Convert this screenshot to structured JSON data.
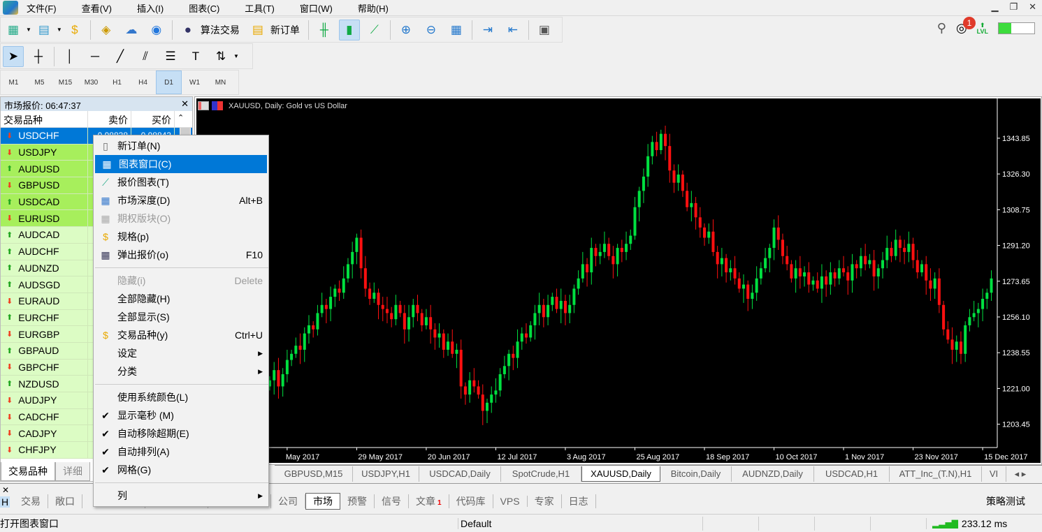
{
  "menubar": {
    "items": [
      "文件(F)",
      "查看(V)",
      "插入(I)",
      "图表(C)",
      "工具(T)",
      "窗口(W)",
      "帮助(H)"
    ]
  },
  "toolbar": {
    "algo_label": "算法交易",
    "new_order_label": "新订单",
    "notification_count": "1",
    "level_label": "LVL",
    "level_fill": 0.35
  },
  "timeframes": {
    "items": [
      "M1",
      "M5",
      "M15",
      "M30",
      "H1",
      "H4",
      "D1",
      "W1",
      "MN"
    ],
    "active": "D1"
  },
  "market_watch": {
    "title": "市场报价: 06:47:37",
    "columns": [
      "交易品种",
      "卖价",
      "买价"
    ],
    "rows": [
      {
        "symbol": "USDCHF",
        "dir": "down",
        "bid": "0.98838",
        "ask": "0.98843",
        "state": "selected"
      },
      {
        "symbol": "USDJPY",
        "dir": "down",
        "state": "hot"
      },
      {
        "symbol": "AUDUSD",
        "dir": "up",
        "state": "hot"
      },
      {
        "symbol": "GBPUSD",
        "dir": "down",
        "state": "hot"
      },
      {
        "symbol": "USDCAD",
        "dir": "up",
        "state": "hot"
      },
      {
        "symbol": "EURUSD",
        "dir": "down",
        "state": "hot"
      },
      {
        "symbol": "AUDCAD",
        "dir": "up",
        "state": "cold"
      },
      {
        "symbol": "AUDCHF",
        "dir": "up",
        "state": "cold"
      },
      {
        "symbol": "AUDNZD",
        "dir": "up",
        "state": "cold"
      },
      {
        "symbol": "AUDSGD",
        "dir": "up",
        "state": "cold"
      },
      {
        "symbol": "EURAUD",
        "dir": "down",
        "state": "cold"
      },
      {
        "symbol": "EURCHF",
        "dir": "up",
        "state": "cold"
      },
      {
        "symbol": "EURGBP",
        "dir": "down",
        "state": "cold"
      },
      {
        "symbol": "GBPAUD",
        "dir": "up",
        "state": "cold"
      },
      {
        "symbol": "GBPCHF",
        "dir": "down",
        "state": "cold"
      },
      {
        "symbol": "NZDUSD",
        "dir": "up",
        "state": "cold"
      },
      {
        "symbol": "AUDJPY",
        "dir": "down",
        "state": "cold"
      },
      {
        "symbol": "CADCHF",
        "dir": "down",
        "state": "cold"
      },
      {
        "symbol": "CADJPY",
        "dir": "down",
        "state": "cold"
      },
      {
        "symbol": "CHFJPY",
        "dir": "down",
        "state": "cold"
      }
    ],
    "tabs": [
      "交易品种",
      "详细"
    ]
  },
  "context_menu": {
    "items": [
      {
        "label": "新订单(N)",
        "icon": "new-order-icon"
      },
      {
        "label": "图表窗口(C)",
        "icon": "chart-window-icon",
        "highlighted": true
      },
      {
        "label": "报价图表(T)",
        "icon": "tick-chart-icon"
      },
      {
        "label": "市场深度(D)",
        "icon": "depth-of-market-icon",
        "shortcut": "Alt+B"
      },
      {
        "label": "期权版块(O)",
        "icon": "options-board-icon",
        "disabled": true
      },
      {
        "label": "规格(p)",
        "icon": "specification-icon"
      },
      {
        "label": "弹出报价(o)",
        "icon": "popup-prices-icon",
        "shortcut": "F10"
      },
      {
        "sep": true
      },
      {
        "label": "隐藏(i)",
        "shortcut": "Delete",
        "disabled": true
      },
      {
        "label": "全部隐藏(H)"
      },
      {
        "label": "全部显示(S)"
      },
      {
        "label": "交易品种(y)",
        "icon": "symbols-icon",
        "shortcut": "Ctrl+U"
      },
      {
        "label": "设定",
        "submenu": true
      },
      {
        "label": "分类",
        "submenu": true
      },
      {
        "sep": true
      },
      {
        "label": "使用系统颜色(L)"
      },
      {
        "label": "显示毫秒 (M)",
        "checked": true
      },
      {
        "label": "自动移除超期(E)",
        "checked": true
      },
      {
        "label": "自动排列(A)",
        "checked": true
      },
      {
        "label": "网格(G)",
        "checked": true
      },
      {
        "sep": true
      },
      {
        "label": "列",
        "submenu": true
      }
    ]
  },
  "chart": {
    "title": "XAUUSD, Daily:  Gold vs US Dollar"
  },
  "chart_data": {
    "type": "candlestick",
    "symbol": "XAUUSD",
    "timeframe": "Daily",
    "ylim": [
      1192,
      1362
    ],
    "grid": false,
    "yticks": [
      "1343.85",
      "1326.30",
      "1308.75",
      "1291.20",
      "1273.65",
      "1256.10",
      "1238.55",
      "1221.00",
      "1203.45"
    ],
    "xticks": [
      "May 2017",
      "29 May 2017",
      "20 Jun 2017",
      "12 Jul 2017",
      "3 Aug 2017",
      "25 Aug 2017",
      "18 Sep 2017",
      "10 Oct 2017",
      "1 Nov 2017",
      "23 Nov 2017",
      "15 Dec 2017"
    ],
    "up_color": "#00e040",
    "down_color": "#ff1010",
    "closes": [
      1225,
      1230,
      1222,
      1228,
      1235,
      1238,
      1242,
      1240,
      1248,
      1252,
      1250,
      1258,
      1262,
      1260,
      1266,
      1270,
      1268,
      1275,
      1282,
      1288,
      1295,
      1280,
      1270,
      1265,
      1268,
      1262,
      1260,
      1258,
      1255,
      1262,
      1258,
      1250,
      1256,
      1262,
      1258,
      1252,
      1256,
      1250,
      1246,
      1248,
      1240,
      1244,
      1238,
      1240,
      1222,
      1218,
      1225,
      1222,
      1218,
      1210,
      1214,
      1218,
      1220,
      1228,
      1232,
      1238,
      1236,
      1244,
      1248,
      1246,
      1252,
      1258,
      1262,
      1256,
      1262,
      1266,
      1260,
      1264,
      1258,
      1262,
      1270,
      1275,
      1282,
      1278,
      1290,
      1286,
      1288,
      1292,
      1286,
      1282,
      1290,
      1288,
      1292,
      1296,
      1310,
      1318,
      1325,
      1335,
      1342,
      1338,
      1346,
      1340,
      1328,
      1322,
      1326,
      1318,
      1310,
      1312,
      1305,
      1300,
      1295,
      1298,
      1288,
      1282,
      1285,
      1278,
      1280,
      1275,
      1270,
      1272,
      1265,
      1268,
      1275,
      1280,
      1285,
      1290,
      1300,
      1294,
      1286,
      1282,
      1275,
      1280,
      1276,
      1278,
      1272,
      1274,
      1270,
      1276,
      1272,
      1278,
      1275,
      1280,
      1278,
      1274,
      1282,
      1280,
      1286,
      1282,
      1284,
      1276,
      1280,
      1284,
      1290,
      1286,
      1294,
      1290,
      1288,
      1292,
      1284,
      1278,
      1282,
      1274,
      1270,
      1275,
      1262,
      1250,
      1245,
      1240,
      1244,
      1238,
      1252,
      1256,
      1258,
      1260,
      1265,
      1268,
      1275
    ]
  },
  "chart_tabs": {
    "items": [
      "GBPUSD,M15",
      "USDJPY,H1",
      "USDCAD,Daily",
      "SpotCrude,H1",
      "XAUUSD,Daily",
      "Bitcoin,Daily",
      "AUDNZD,Daily",
      "USDCAD,H1",
      "ATT_Inc_(T.N),H1",
      "VI"
    ],
    "active": "XAUUSD,Daily"
  },
  "terminal": {
    "side_label": "H",
    "tabs": [
      "交易",
      "敞口",
      "",
      "",
      "",
      "公司",
      "市场",
      "预警",
      "信号",
      "文章",
      "代码库",
      "VPS",
      "专家",
      "日志"
    ],
    "active": "市场",
    "article_badge": "1",
    "tester_label": "策略测试"
  },
  "status": {
    "hint": "打开图表窗口",
    "profile": "Default",
    "ping": "233.12 ms"
  }
}
